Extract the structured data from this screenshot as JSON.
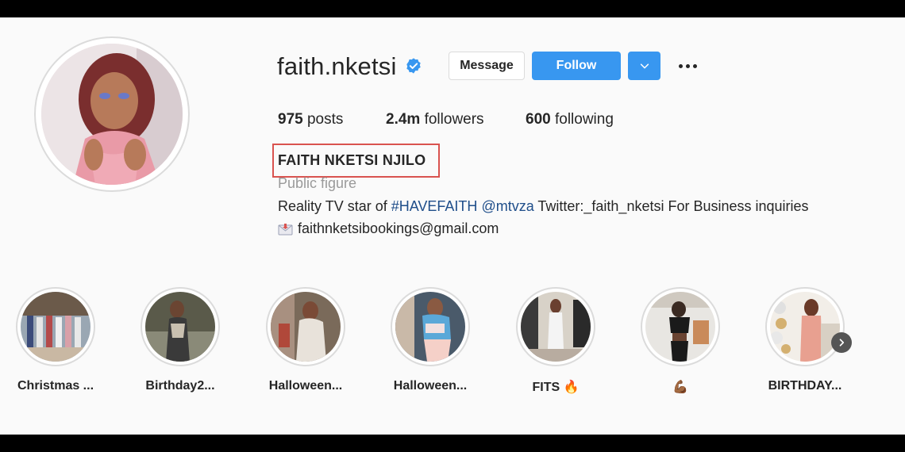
{
  "profile": {
    "username": "faith.nketsi",
    "full_name": "FAITH NKETSI NJILO",
    "category": "Public figure",
    "bio_prefix": "Reality TV star of ",
    "bio_hashtag": "#HAVEFAITH",
    "bio_mention": "@mtvza",
    "bio_suffix": " Twitter:_faith_nketsi For Business inquiries",
    "email": "faithnketsibookings@gmail.com",
    "verified_icon": "verified-badge-icon"
  },
  "actions": {
    "message_label": "Message",
    "follow_label": "Follow",
    "dropdown_icon": "chevron-down-icon",
    "more_icon": "ellipsis-icon"
  },
  "stats": {
    "posts_count": "975",
    "posts_label": " posts",
    "followers_count": "2.4m",
    "followers_label": " followers",
    "following_count": "600",
    "following_label": " following"
  },
  "highlights": [
    {
      "label": "Christmas ..."
    },
    {
      "label": "Birthday2..."
    },
    {
      "label": "Halloween..."
    },
    {
      "label": "Halloween..."
    },
    {
      "label": "FITS 🔥"
    },
    {
      "label": "💪🏾"
    },
    {
      "label": "BIRTHDAY..."
    }
  ],
  "colors": {
    "accent_blue": "#3897f0",
    "highlight_box": "#d9534f",
    "link_blue": "#1f4e8a",
    "muted_gray": "#9a9a9a"
  }
}
